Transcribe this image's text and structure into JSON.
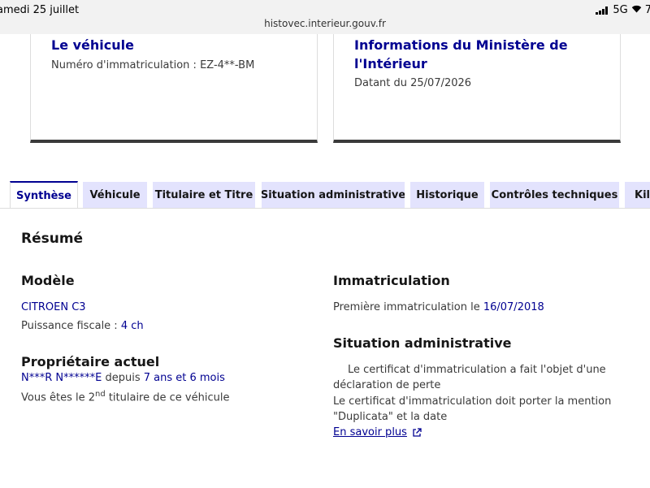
{
  "status": {
    "date": "amedi 25 juillet",
    "network": "5G",
    "battery": "7",
    "url": "histovec.interieur.gouv.fr"
  },
  "cards": [
    {
      "title": "Le véhicule",
      "subtitle": "Numéro d'immatriculation : EZ-4**-BM"
    },
    {
      "title_line1": "Informations du Ministère de",
      "title_line2": "l'Intérieur",
      "subtitle": "Datant du 25/07/2026"
    }
  ],
  "tabs": [
    {
      "label": "Synthèse",
      "active": true
    },
    {
      "label": "Véhicule"
    },
    {
      "label": "Titulaire et Titre"
    },
    {
      "label": "Situation administrative"
    },
    {
      "label": "Historique"
    },
    {
      "label": "Contrôles techniques"
    },
    {
      "label": "Kil"
    }
  ],
  "summary": {
    "heading": "Résumé",
    "model": {
      "heading": "Modèle",
      "name": "CITROEN C3",
      "power_label": "Puissance fiscale : ",
      "power_value": "4 ch"
    },
    "owner": {
      "heading": "Propriétaire actuel",
      "name": "N***R N******E",
      "since_label": " depuis ",
      "since_value": "7 ans et 6 mois",
      "rank_prefix": "Vous êtes le 2",
      "rank_sup": "nd",
      "rank_suffix": " titulaire de ce véhicule"
    },
    "registration": {
      "heading": "Immatriculation",
      "label": "Première immatriculation le ",
      "date": "16/07/2018"
    },
    "admin": {
      "heading": "Situation administrative",
      "line1": "Le certificat d'immatriculation a fait l'objet d'une",
      "line2": "déclaration de perte",
      "line3": "Le certificat d'immatriculation doit porter la mention",
      "line4": "\"Duplicata\" et la date",
      "link": "En savoir plus"
    }
  }
}
